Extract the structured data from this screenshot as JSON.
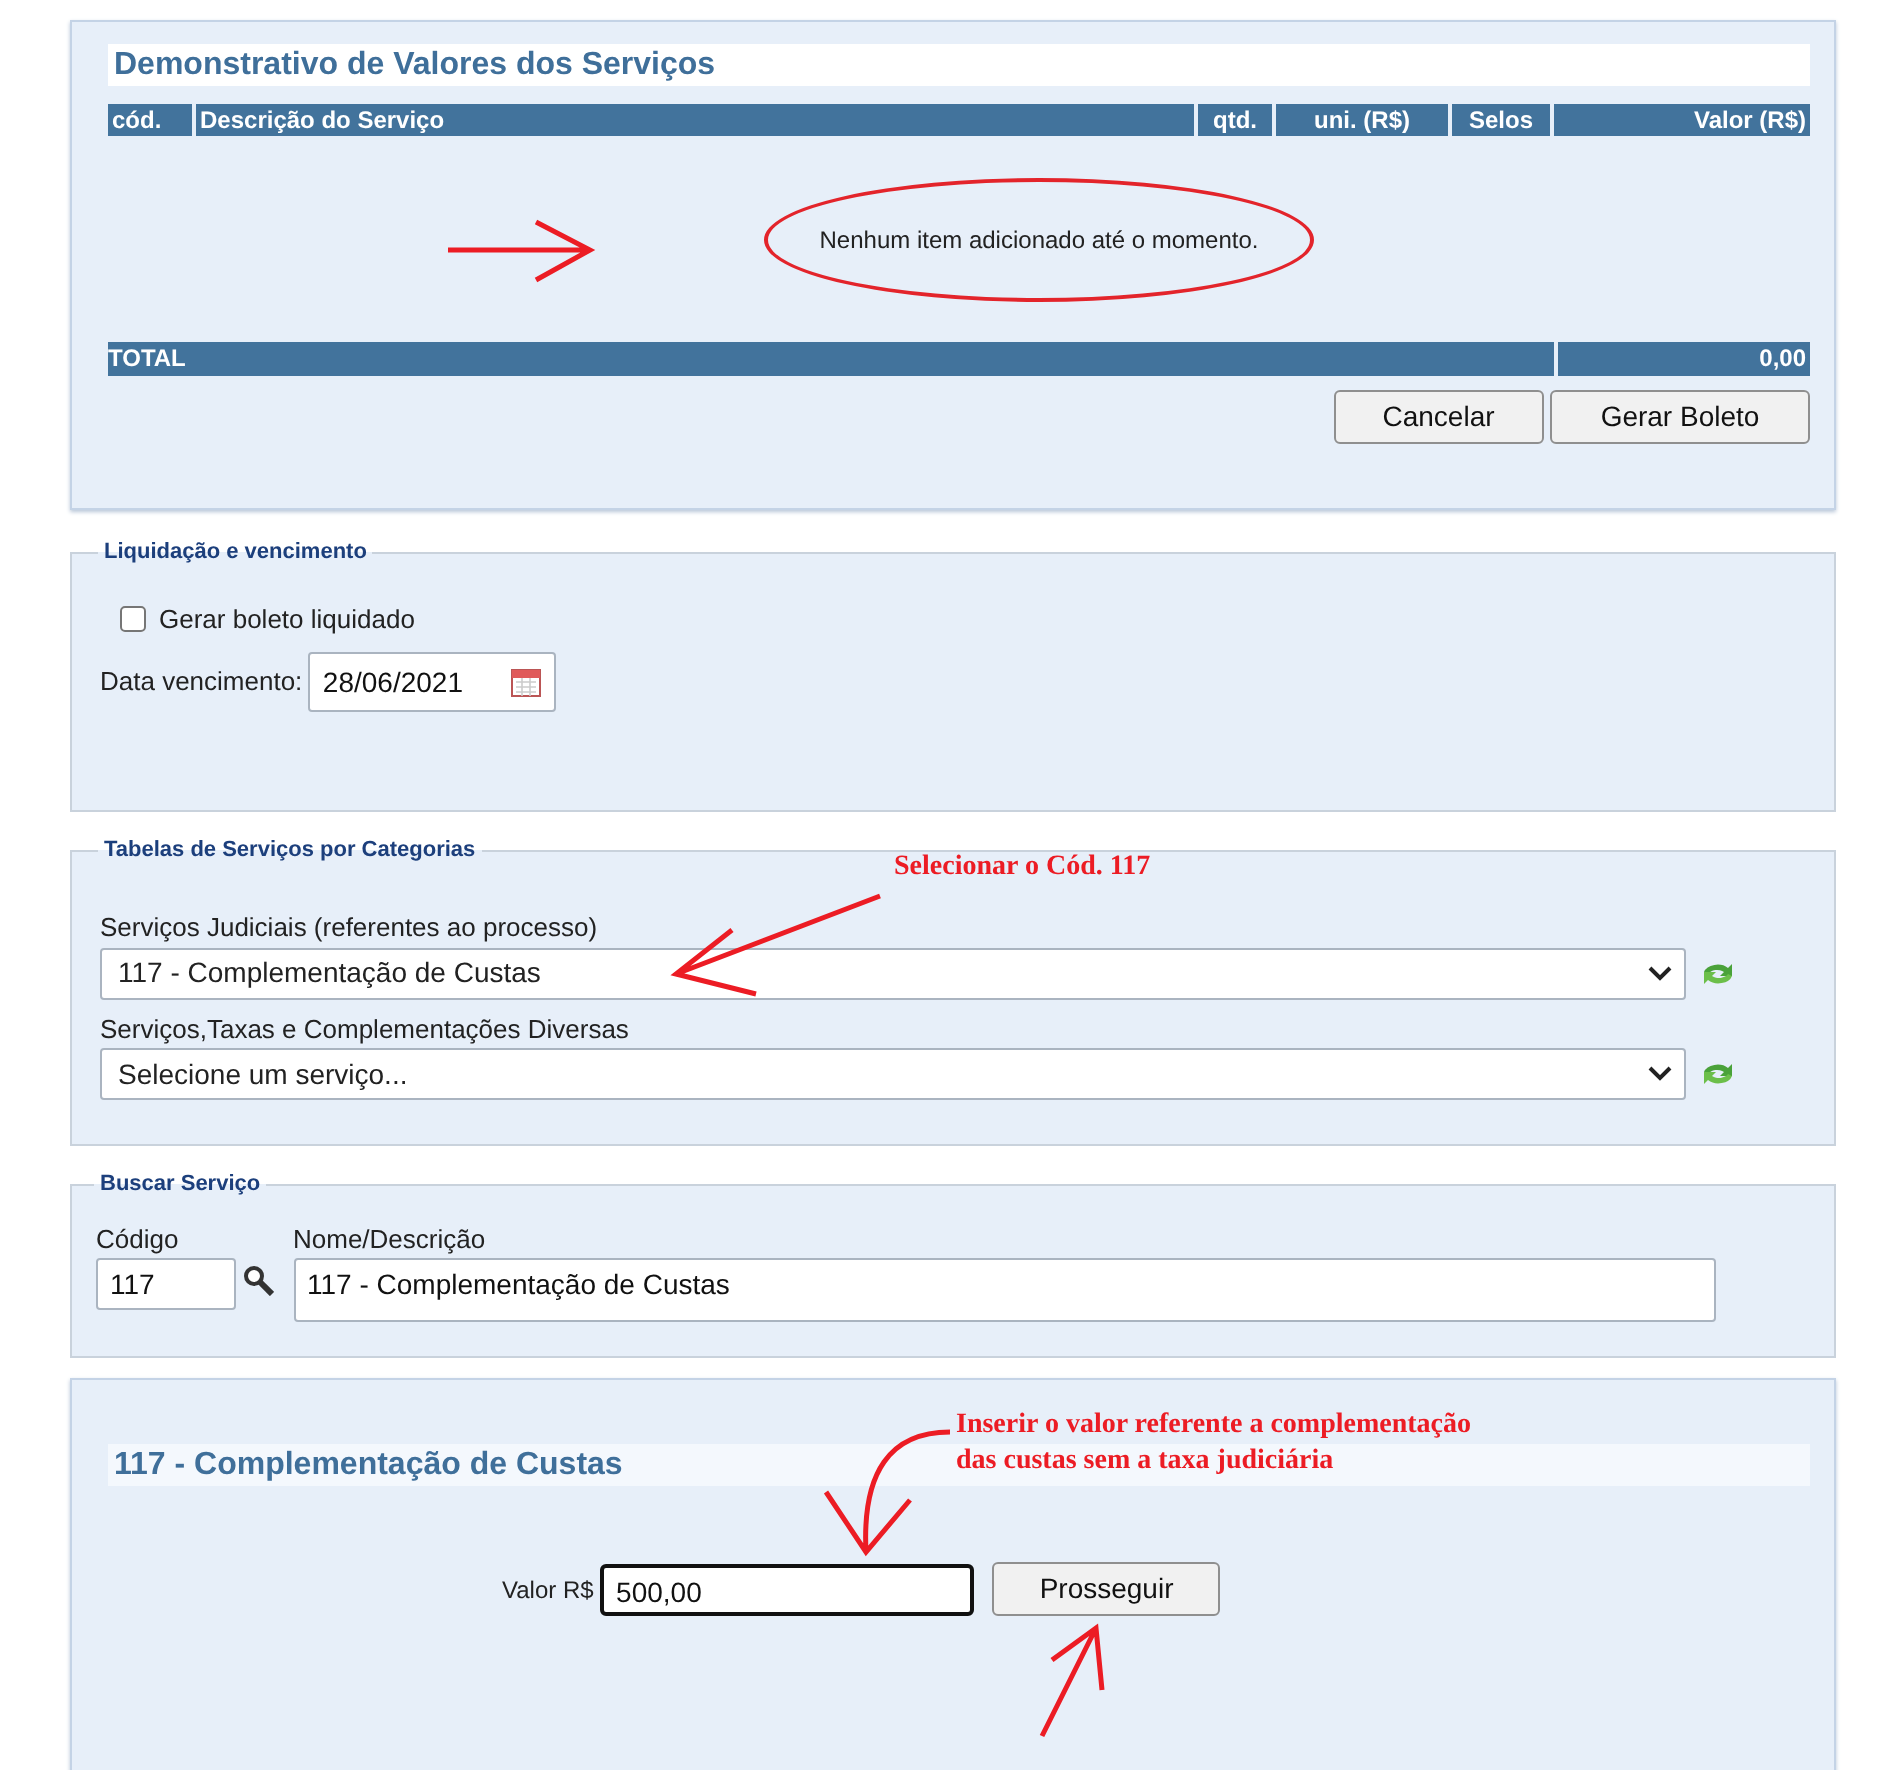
{
  "services_panel": {
    "title": "Demonstrativo de Valores dos Serviços",
    "columns": [
      "cód.",
      "Descrição do Serviço",
      "qtd.",
      "uni. (R$)",
      "Selos",
      "Valor (R$)"
    ],
    "empty_message": "Nenhum item adicionado até o momento.",
    "total_label": "TOTAL",
    "total_value": "0,00",
    "buttons": [
      "Cancelar",
      "Gerar Boleto"
    ]
  },
  "settlement": {
    "legend": "Liquidação e vencimento",
    "checkbox": {
      "label": "Gerar boleto liquidado",
      "checked": false
    },
    "due_date": {
      "label": "Data vencimento:",
      "value": "28/06/2021"
    }
  },
  "categories": {
    "legend": "Tabelas de Serviços por Categorias",
    "selects": [
      {
        "label": "Serviços Judiciais (referentes ao processo)",
        "value": "117 - Complementação de Custas"
      },
      {
        "label": "Serviços,Taxas e Complementações Diversas",
        "value": "Selecione um serviço..."
      }
    ]
  },
  "search": {
    "legend": "Buscar Serviço",
    "code": {
      "label": "Código",
      "value": "117"
    },
    "name": {
      "label": "Nome/Descrição",
      "value": "117 - Complementação de Custas"
    }
  },
  "service_form": {
    "title": "117 - Complementação de Custas",
    "amount": {
      "label": "Valor R$",
      "value": "500,00"
    },
    "button": "Prosseguir"
  },
  "annotations": [
    {
      "text": "Selecionar o Cód. 117"
    },
    {
      "text": "Inserir o valor referente a complementação das custas sem a taxa judiciária"
    }
  ]
}
